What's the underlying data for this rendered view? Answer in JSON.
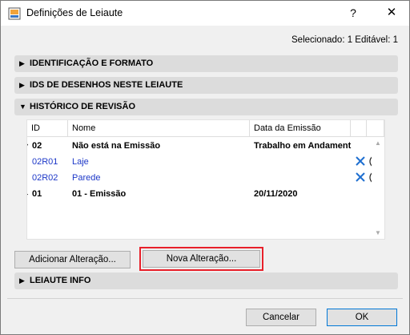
{
  "window": {
    "title": "Definições de Leiaute",
    "help": "?",
    "close": "✕"
  },
  "selection_info": "Selecionado: 1 Editável: 1",
  "sections": {
    "ident": {
      "label": "IDENTIFICAÇÃO E FORMATO",
      "arrow": "▶"
    },
    "ids": {
      "label": "IDS DE DESENHOS NESTE LEIAUTE",
      "arrow": "▶"
    },
    "history": {
      "label": "HISTÓRICO DE REVISÃO",
      "arrow": "▼"
    },
    "info": {
      "label": "LEIAUTE INFO",
      "arrow": "▶"
    }
  },
  "table": {
    "headers": [
      "ID",
      "Nome",
      "Data da Emissão"
    ],
    "rows": [
      {
        "expander": "▼",
        "id": "02",
        "name": "Não está na Emissão",
        "date": "Trabalho em Andament"
      },
      {
        "id": "02R01",
        "name": "Laje"
      },
      {
        "id": "02R02",
        "name": "Parede"
      },
      {
        "expander": "▶",
        "id": "01",
        "name": "01 - Emissão",
        "date": "20/11/2020"
      }
    ],
    "scroll_up": "▲",
    "scroll_down": "▼"
  },
  "buttons": {
    "add_change": "Adicionar Alteração...",
    "new_change": "Nova Alteração...",
    "cancel": "Cancelar",
    "ok": "OK"
  }
}
